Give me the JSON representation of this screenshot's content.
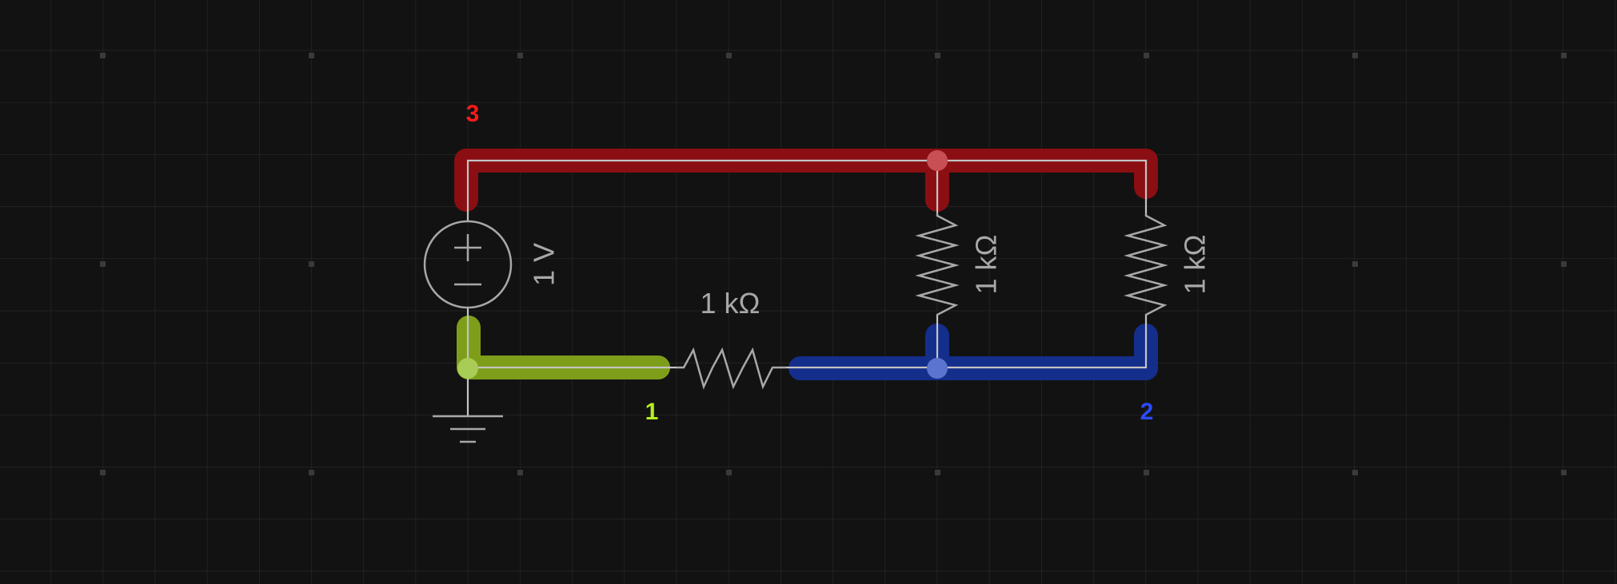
{
  "source": {
    "value_label": "1 V"
  },
  "resistors": [
    {
      "id": "r-series",
      "value_label": "1 kΩ"
    },
    {
      "id": "r-mid",
      "value_label": "1 kΩ"
    },
    {
      "id": "r-right",
      "value_label": "1 kΩ"
    }
  ],
  "nodes": [
    {
      "id": "1",
      "label": "1",
      "color": "#b5f020"
    },
    {
      "id": "2",
      "label": "2",
      "color": "#2a4bff"
    },
    {
      "id": "3",
      "label": "3",
      "color": "#ff1a1a"
    }
  ],
  "net_colors": {
    "node1": "#7e9e1a",
    "node2": "#142e8c",
    "node3": "#8a0e12"
  },
  "ground": true
}
